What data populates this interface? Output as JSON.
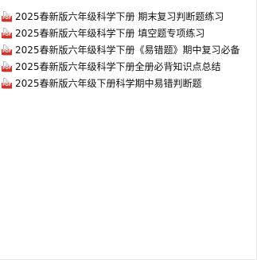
{
  "files": [
    {
      "name": "2025春新版六年级科学下册 期末复习判断题练习",
      "icon": "pdf-icon"
    },
    {
      "name": "2025春新版六年级科学下册 填空题专项练习",
      "icon": "pdf-icon"
    },
    {
      "name": "2025春新版六年级科学下册《易错题》期中复习必备",
      "icon": "pdf-icon"
    },
    {
      "name": "2025春新版六年级科学下册全册必背知识点总结",
      "icon": "pdf-icon"
    },
    {
      "name": "2025春新版六年级下册科学期中易错判断题",
      "icon": "pdf-icon"
    }
  ],
  "icon_label": "PDF",
  "colors": {
    "pdf_red": "#d93025",
    "text": "#111111",
    "background": "#ffffff"
  }
}
